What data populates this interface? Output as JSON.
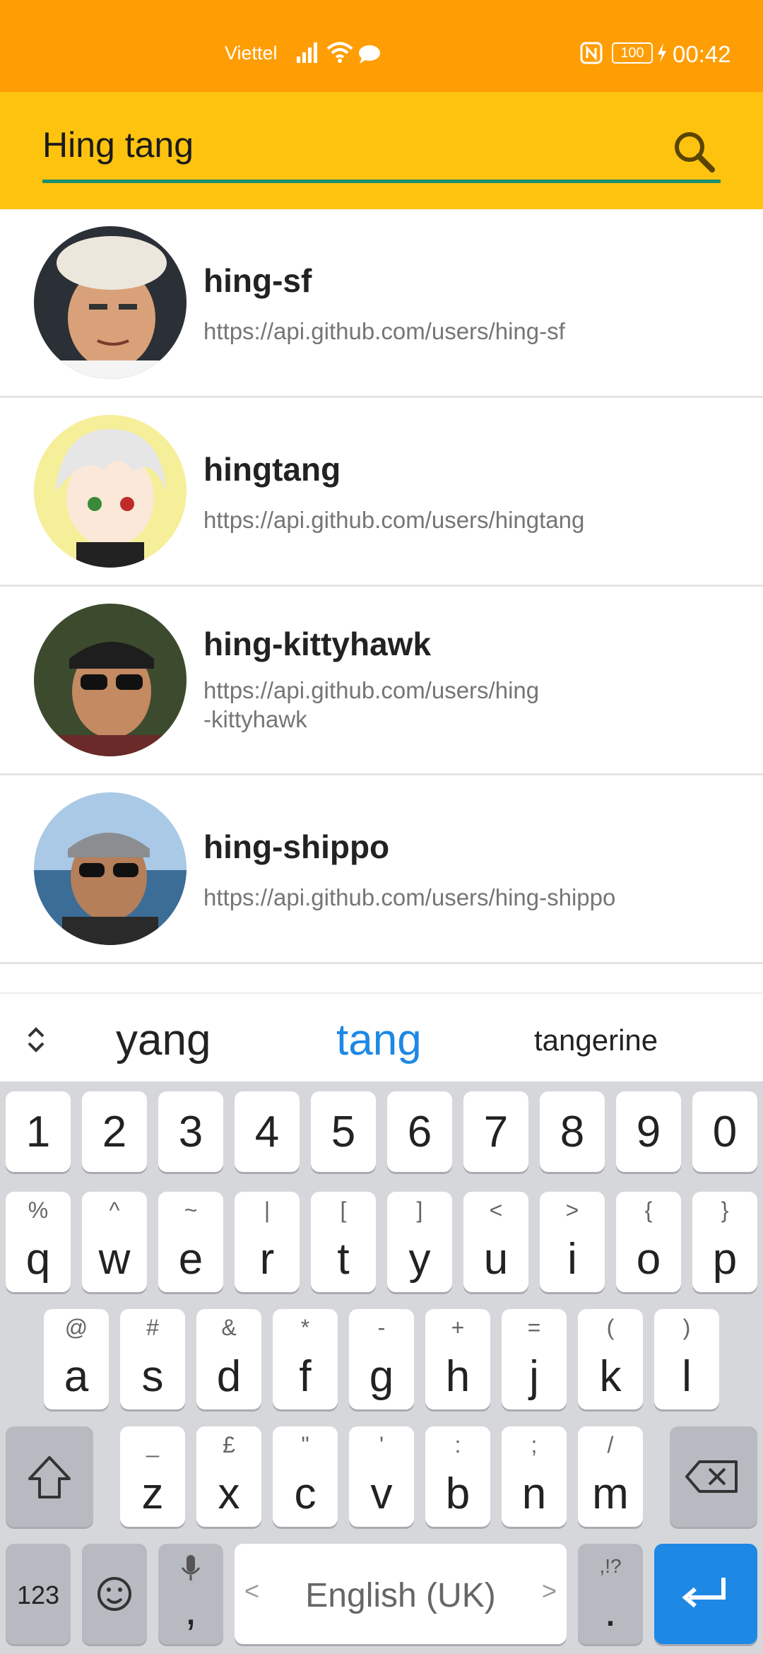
{
  "status_bar": {
    "carrier": "Viettel",
    "battery": "100",
    "time": "00:42"
  },
  "search": {
    "value": "Hing tang",
    "search_icon": "search-icon"
  },
  "results": [
    {
      "login": "hing-sf",
      "url": "https://api.github.com/users/hing-sf"
    },
    {
      "login": "hingtang",
      "url": "https://api.github.com/users/hingtang"
    },
    {
      "login": "hing-kittyhawk",
      "url": "https://api.github.com/users/hing\n-kittyhawk"
    },
    {
      "login": "hing-shippo",
      "url": "https://api.github.com/users/hing-shippo"
    }
  ],
  "suggestions": {
    "left": "yang",
    "center": "tang",
    "right": "tangerine"
  },
  "keyboard": {
    "numbers": [
      "1",
      "2",
      "3",
      "4",
      "5",
      "6",
      "7",
      "8",
      "9",
      "0"
    ],
    "row1": [
      {
        "main": "q",
        "sub": "%"
      },
      {
        "main": "w",
        "sub": "^"
      },
      {
        "main": "e",
        "sub": "~"
      },
      {
        "main": "r",
        "sub": "|"
      },
      {
        "main": "t",
        "sub": "["
      },
      {
        "main": "y",
        "sub": "]"
      },
      {
        "main": "u",
        "sub": "<"
      },
      {
        "main": "i",
        "sub": ">"
      },
      {
        "main": "o",
        "sub": "{"
      },
      {
        "main": "p",
        "sub": "}"
      }
    ],
    "row2": [
      {
        "main": "a",
        "sub": "@"
      },
      {
        "main": "s",
        "sub": "#"
      },
      {
        "main": "d",
        "sub": "&"
      },
      {
        "main": "f",
        "sub": "*"
      },
      {
        "main": "g",
        "sub": "-"
      },
      {
        "main": "h",
        "sub": "+"
      },
      {
        "main": "j",
        "sub": "="
      },
      {
        "main": "k",
        "sub": "("
      },
      {
        "main": "l",
        "sub": ")"
      }
    ],
    "row3": [
      {
        "main": "z",
        "sub": "_"
      },
      {
        "main": "x",
        "sub": "£"
      },
      {
        "main": "c",
        "sub": "\""
      },
      {
        "main": "v",
        "sub": "'"
      },
      {
        "main": "b",
        "sub": ":"
      },
      {
        "main": "n",
        "sub": ";"
      },
      {
        "main": "m",
        "sub": "/"
      }
    ],
    "symbols_key": "123",
    "comma_key": ",",
    "space_label": "English (UK)",
    "space_left_arrow": "<",
    "space_right_arrow": ">",
    "period_key": ".",
    "period_sub": ",!?"
  },
  "colors": {
    "status_bar": "#FF9D05",
    "search_bar": "#FDC30F",
    "underline": "#1E8F6E",
    "suggestion_active": "#1E88E5",
    "enter_key": "#1E88E5"
  }
}
